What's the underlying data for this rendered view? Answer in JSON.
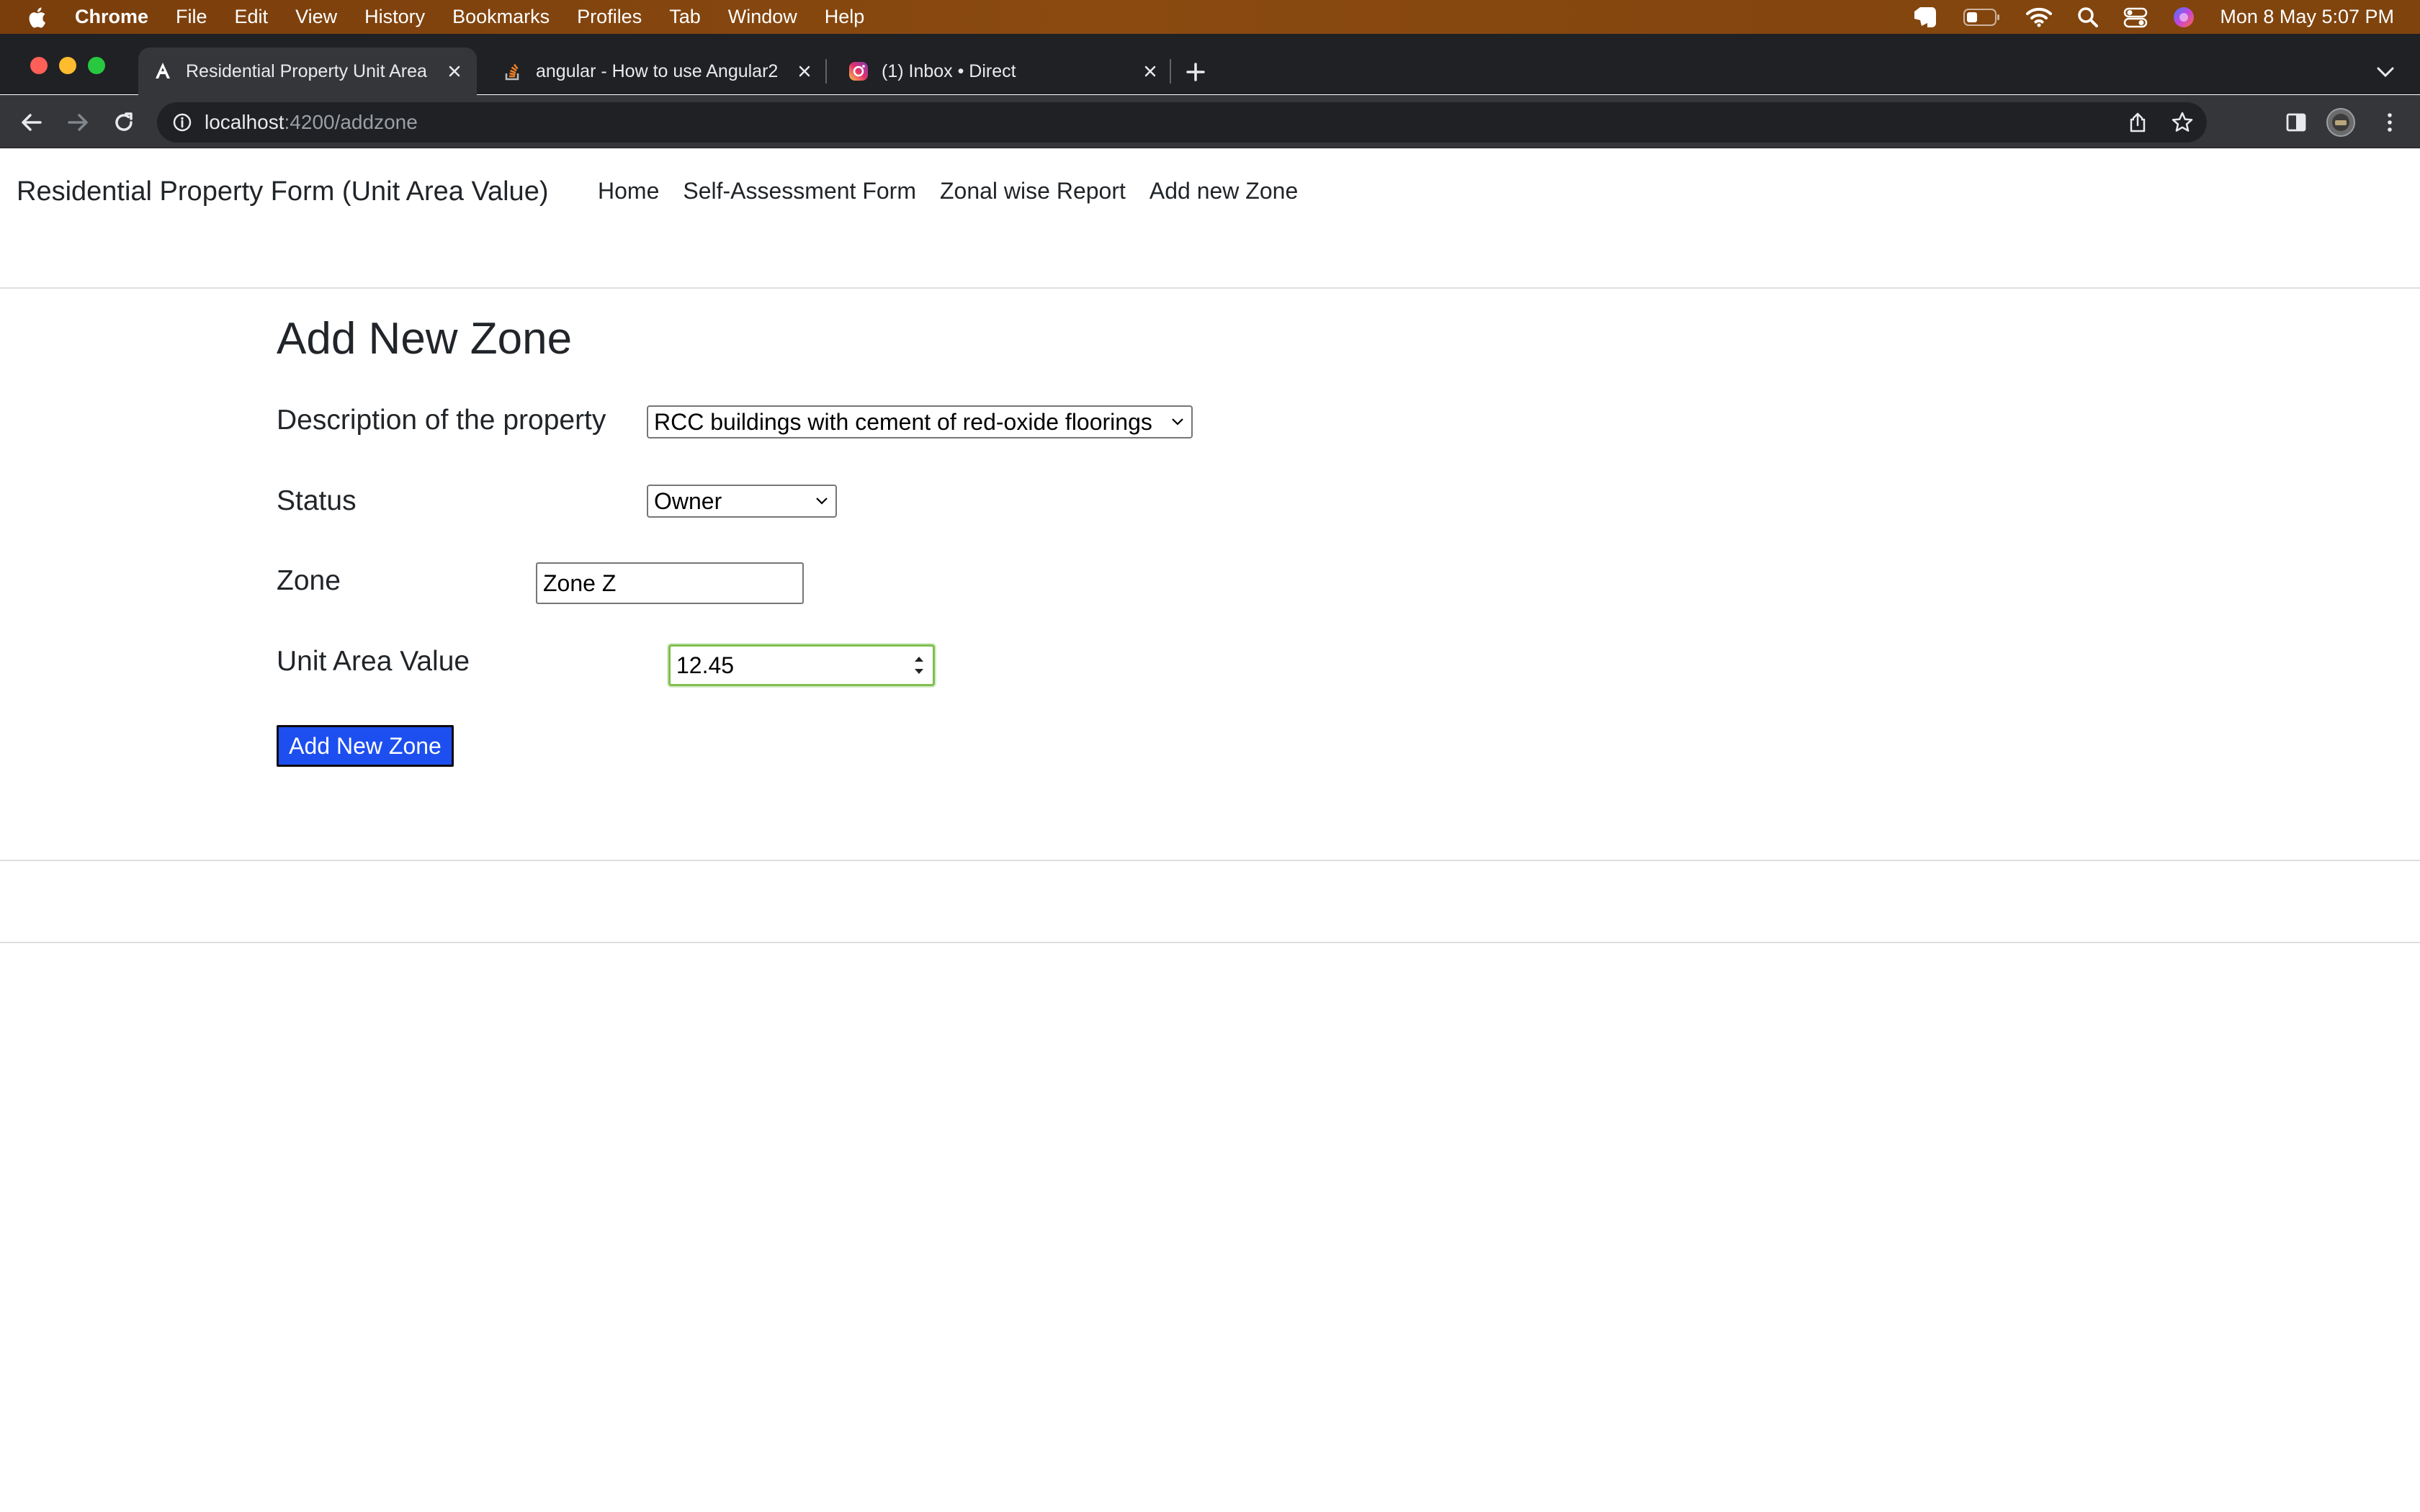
{
  "menubar": {
    "app_name": "Chrome",
    "items": [
      "File",
      "Edit",
      "View",
      "History",
      "Bookmarks",
      "Profiles",
      "Tab",
      "Window",
      "Help"
    ],
    "clock": "Mon 8 May  5:07 PM",
    "icons": [
      "apple-icon",
      "evernote-icon",
      "battery-icon",
      "wifi-icon",
      "spotlight-search-icon",
      "control-center-icon",
      "siri-icon"
    ]
  },
  "browser": {
    "tabs": [
      {
        "title": "Residential Property Unit Area",
        "favicon": "angular-icon",
        "active": true
      },
      {
        "title": "angular - How to use Angular2",
        "favicon": "stackoverflow-icon",
        "active": false
      },
      {
        "title": "(1) Inbox • Direct",
        "favicon": "instagram-icon",
        "active": false
      }
    ],
    "new_tab_label": "+",
    "url_host": "localhost",
    "url_path": ":4200/addzone"
  },
  "navbar": {
    "brand": "Residential Property Form (Unit Area Value)",
    "links": [
      "Home",
      "Self-Assessment Form",
      "Zonal wise Report",
      "Add new Zone"
    ]
  },
  "form": {
    "title": "Add New Zone",
    "description_label": "Description of the property",
    "description_value": "RCC buildings with cement of red-oxide floorings",
    "status_label": "Status",
    "status_value": "Owner",
    "zone_label": "Zone",
    "zone_value": "Zone Z",
    "unit_area_label": "Unit Area Value",
    "unit_area_value": "12.45",
    "submit_label": "Add New Zone"
  },
  "colors": {
    "menubar_bg": "#7f430d",
    "tabstrip_bg": "#202124",
    "active_tab_bg": "#35363a",
    "submit_bg": "#1d4ff0",
    "focus_border": "#7fbf4e"
  }
}
